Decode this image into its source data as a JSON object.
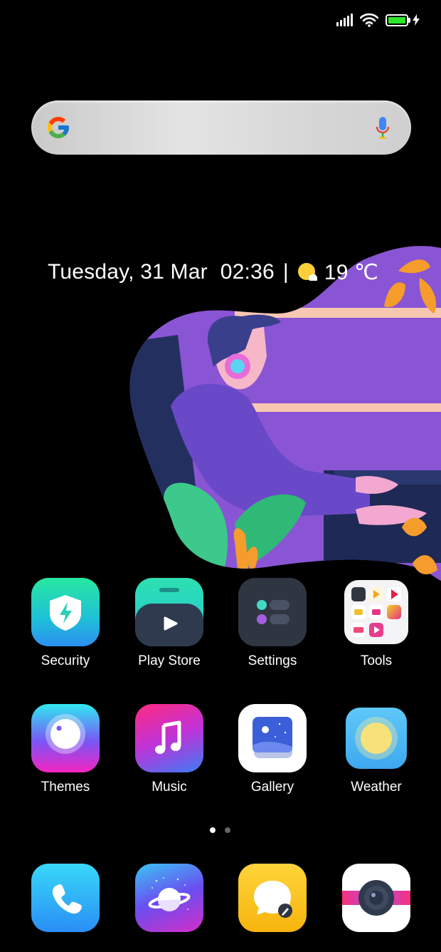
{
  "status_bar": {
    "signal_icon": "signal-bars-icon",
    "wifi_icon": "wifi-icon",
    "battery_icon": "battery-charging-icon",
    "battery_color": "#2ee62b"
  },
  "search_bar": {
    "logo_icon": "google-g-icon",
    "mic_icon": "microphone-icon"
  },
  "clock_widget": {
    "date": "Tuesday, 31 Mar",
    "time": "02:36",
    "separator": "|",
    "weather_icon": "partly-sunny-icon",
    "temperature": "19 ℃"
  },
  "apps_row1": [
    {
      "label": "Security",
      "icon": "shield-bolt-icon"
    },
    {
      "label": "Play Store",
      "icon": "play-store-icon"
    },
    {
      "label": "Settings",
      "icon": "settings-toggles-icon"
    },
    {
      "label": "Tools",
      "icon": "tools-folder-icon"
    }
  ],
  "apps_row2": [
    {
      "label": "Themes",
      "icon": "themes-icon"
    },
    {
      "label": "Music",
      "icon": "music-note-icon"
    },
    {
      "label": "Gallery",
      "icon": "gallery-icon"
    },
    {
      "label": "Weather",
      "icon": "sun-icon"
    }
  ],
  "page_indicator": {
    "pages": 2,
    "current": 1
  },
  "dock": [
    {
      "icon": "phone-icon"
    },
    {
      "icon": "browser-planet-icon"
    },
    {
      "icon": "messages-icon"
    },
    {
      "icon": "camera-icon"
    }
  ]
}
